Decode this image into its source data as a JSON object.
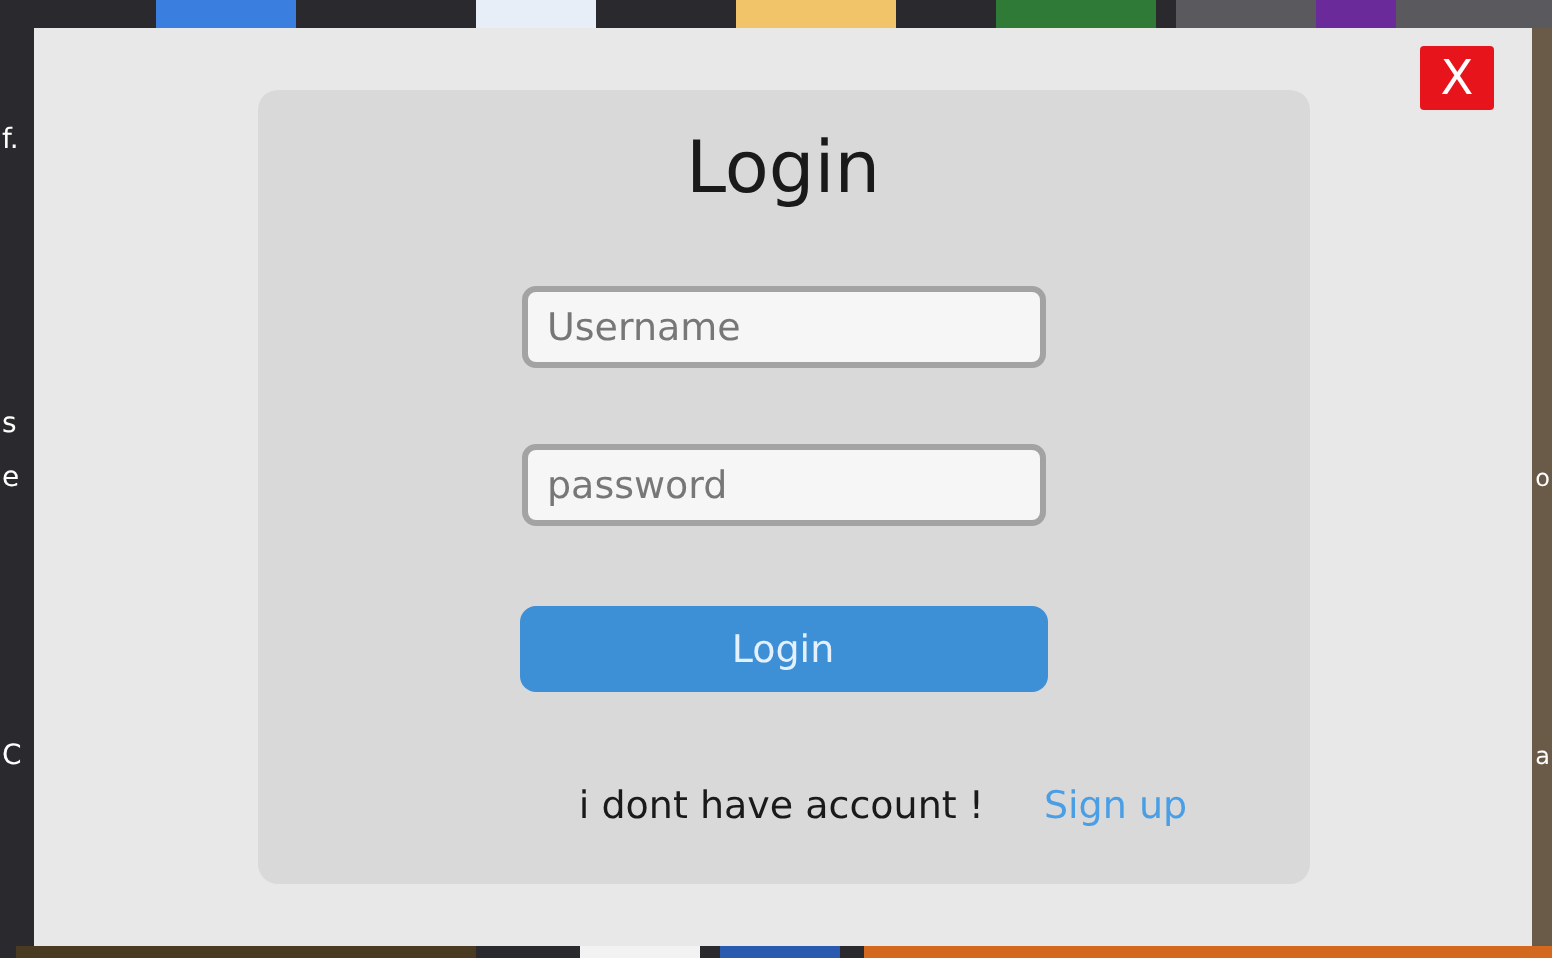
{
  "backdrop": {
    "kind": "picture",
    "left_edge_text": [
      "f.",
      "s",
      "e",
      "C"
    ],
    "right_edge_text": [
      "o",
      "a"
    ]
  },
  "dialog": {
    "close": "X",
    "title": "Login",
    "fields": [
      {
        "placeholder": "Username"
      },
      {
        "placeholder": "password"
      }
    ],
    "submit": "Login",
    "footer": {
      "text": "i dont have account !",
      "link": "Sign up"
    }
  }
}
